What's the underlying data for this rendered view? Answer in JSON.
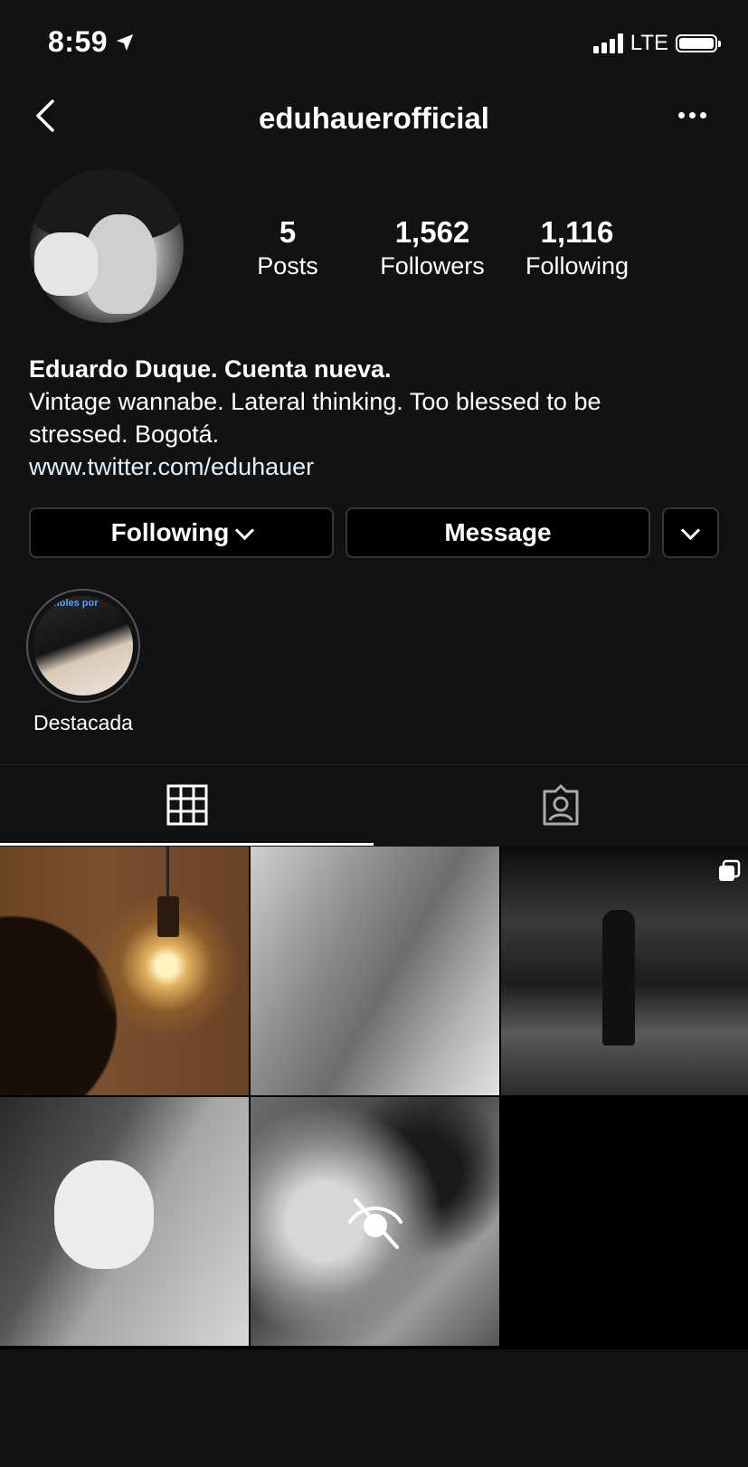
{
  "status_bar": {
    "time": "8:59",
    "network": "LTE"
  },
  "header": {
    "username": "eduhauerofficial"
  },
  "stats": [
    {
      "value": "5",
      "label": "Posts"
    },
    {
      "value": "1,562",
      "label": "Followers"
    },
    {
      "value": "1,116",
      "label": "Following"
    }
  ],
  "bio": {
    "name": "Eduardo Duque. Cuenta nueva.",
    "text": "Vintage wannabe. Lateral thinking. Too blessed to be stressed. Bogotá.",
    "link": "www.twitter.com/eduhauer"
  },
  "actions": {
    "following_label": "Following",
    "message_label": "Message"
  },
  "highlight": {
    "label": "Destacada",
    "overlay_text": "ñoles por"
  },
  "tabs": {
    "active": "grid"
  }
}
